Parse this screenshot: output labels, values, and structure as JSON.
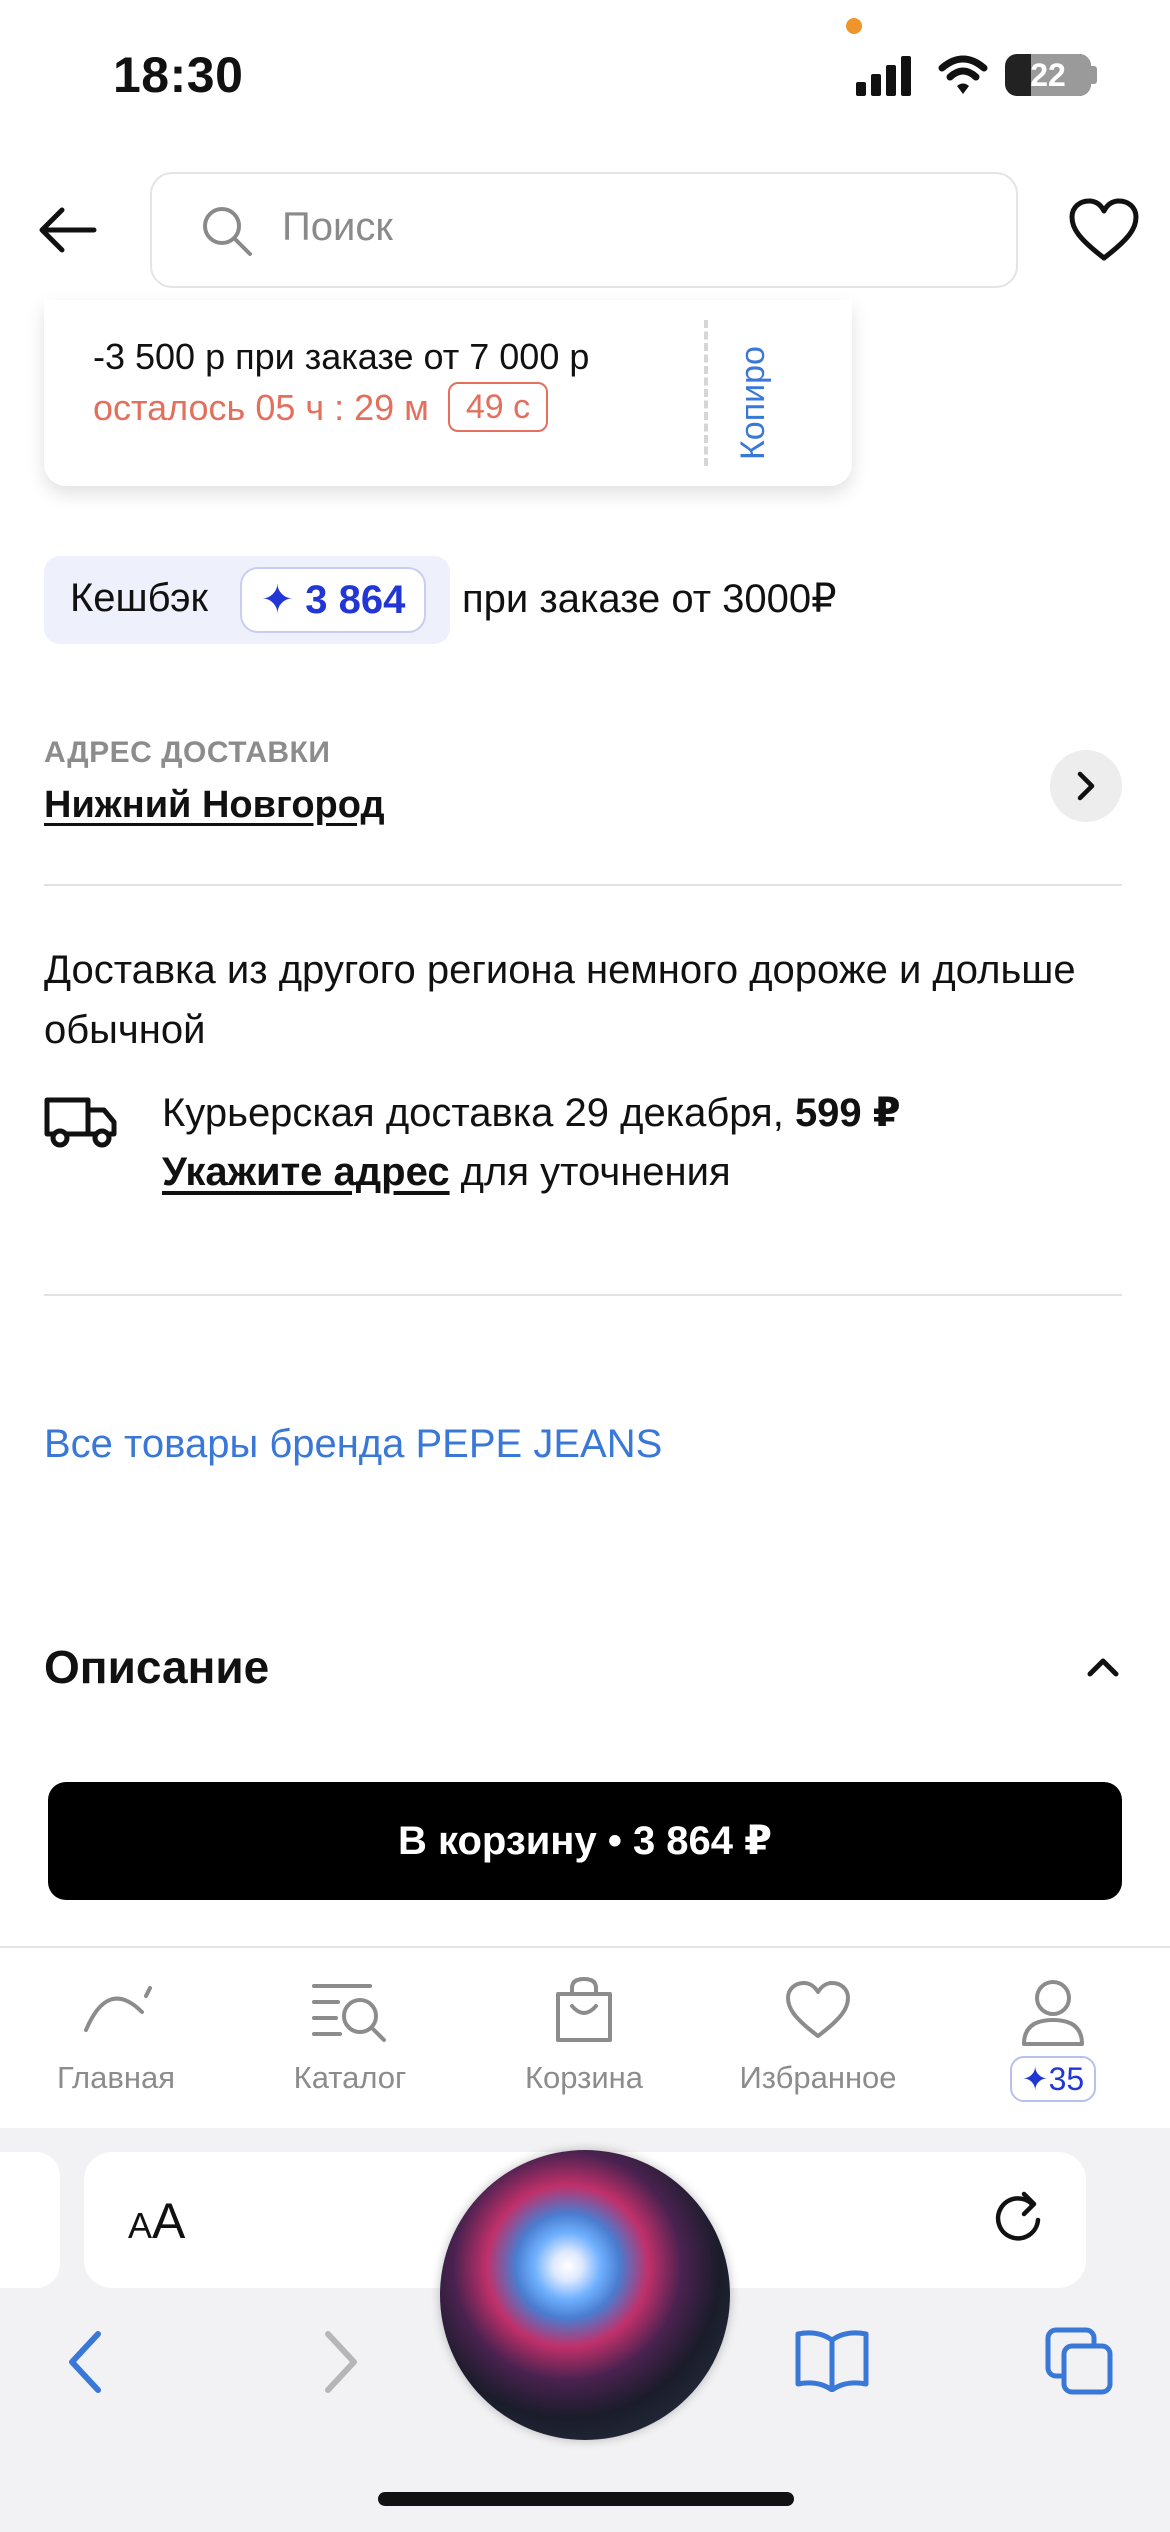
{
  "status_bar": {
    "time": "18:30",
    "battery": "22"
  },
  "header": {
    "search_placeholder": "Поиск"
  },
  "promo": {
    "discount_text": "-3 500 р при заказе от 7 000 р",
    "countdown_prefix": "осталось 05 ч : 29 м",
    "countdown_seconds": "49 с",
    "copy_label": "Копиро"
  },
  "cashback": {
    "label": "Кешбэк",
    "points": "✦ 3 864",
    "condition": "при заказе от 3000₽"
  },
  "delivery": {
    "address_label": "АДРЕС ДОСТАВКИ",
    "city": "Нижний Новгород",
    "region_note": "Доставка из другого региона немного дороже и дольше обычной",
    "courier_text": "Курьерская доставка 29 декабря, ",
    "courier_price": "599 ₽",
    "specify_address": "Укажите адрес",
    "specify_suffix": " для уточнения"
  },
  "brand_link": "Все товары бренда PEPE JEANS",
  "description": {
    "title": "Описание"
  },
  "cart_button": "В корзину • 3 864 ₽",
  "tabbar": {
    "items": [
      {
        "label": "Главная",
        "icon": "home-arc-icon"
      },
      {
        "label": "Каталог",
        "icon": "catalog-search-icon"
      },
      {
        "label": "Корзина",
        "icon": "bag-icon"
      },
      {
        "label": "Избранное",
        "icon": "heart-icon"
      },
      {
        "label": "",
        "icon": "profile-icon",
        "badge": "✦35"
      }
    ]
  },
  "safari": {
    "text_size": "AA"
  },
  "colors": {
    "accent_blue": "#3a78d8",
    "points_blue": "#2236d6",
    "timer_red": "#e2705d"
  }
}
